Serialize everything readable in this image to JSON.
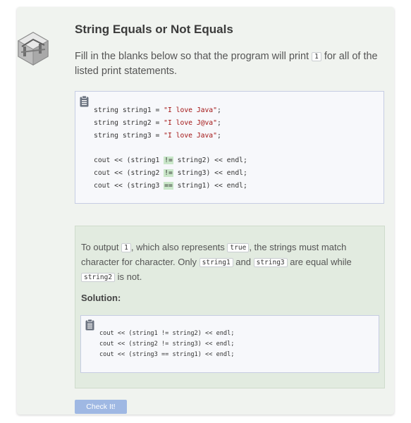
{
  "exercise": {
    "title": "String Equals or Not Equals",
    "instructions": {
      "before": "Fill in the blanks below so that the program will print ",
      "code": "1",
      "after": " for all of the listed print statements."
    }
  },
  "code_editor": {
    "lines": {
      "l1_pre": "string string1 = ",
      "l1_str": "\"I love Java\"",
      "l1_end": ";",
      "l2_pre": "string string2 = ",
      "l2_str": "\"I love J@va\"",
      "l2_end": ";",
      "l3_pre": "string string3 = ",
      "l3_str": "\"I love Java\"",
      "l3_end": ";",
      "l4_pre": "cout << (string1 ",
      "l4_blank": "!=",
      "l4_post": " string2) << endl;",
      "l5_pre": "cout << (string2 ",
      "l5_blank": "!=",
      "l5_post": " string3) << endl;",
      "l6_pre": "cout << (string3 ",
      "l6_blank": "==",
      "l6_post": " string1) << endl;"
    }
  },
  "solution": {
    "explanation": {
      "t1": "To output ",
      "c1": "1",
      "t2": ", which also represents ",
      "c2": "true",
      "t3": ", the strings must match character for character. Only ",
      "c3": "string1",
      "t4": " and ",
      "c4": "string3",
      "t5": " are equal while ",
      "c5": "string2",
      "t6": " is not."
    },
    "label": "Solution:",
    "code": "cout << (string1 != string2) << endl;\ncout << (string2 != string3) << endl;\ncout << (string3 == string1) << endl;"
  },
  "check_button": {
    "label": "Check It!"
  },
  "colors": {
    "card_bg": "#f0f3ef",
    "solution_bg": "#e2ebe0",
    "code_bg": "#f7f8fb",
    "string_literal": "#a31515",
    "blank_highlight": "#c9e7c9",
    "button_bg": "#9fb8e3"
  },
  "icons": {
    "badge": "isometric-bridge-icon",
    "copy": "clipboard-icon"
  }
}
